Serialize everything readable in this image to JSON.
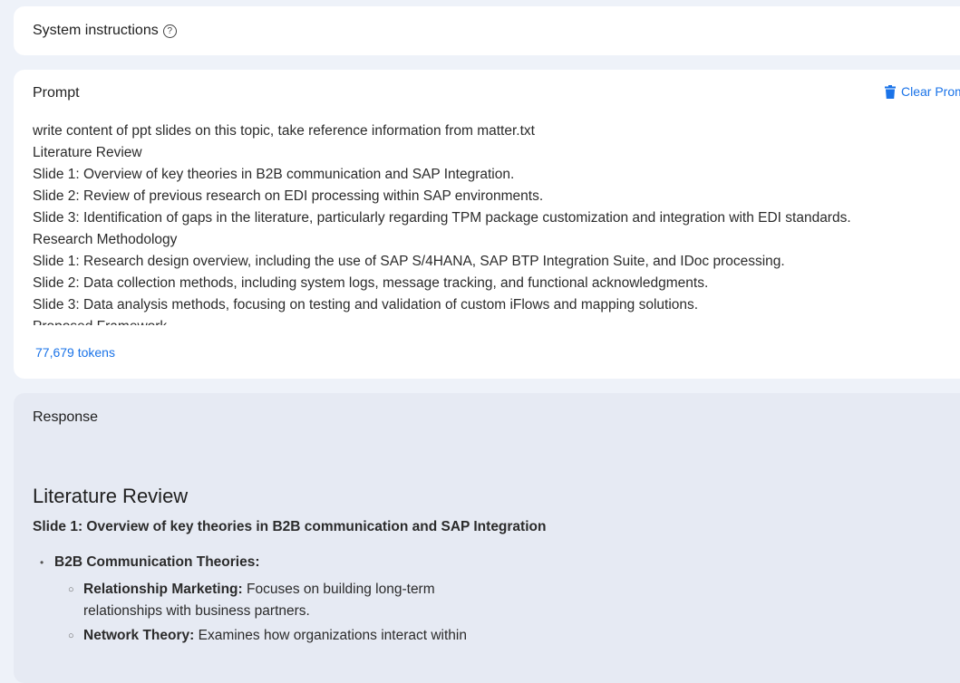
{
  "system": {
    "title": "System instructions",
    "help_glyph": "?"
  },
  "prompt": {
    "title": "Prompt",
    "clear_label": "Clear Prompt",
    "lines": [
      "write content of ppt slides on this topic, take reference information from matter.txt",
      "Literature Review",
      "Slide 1: Overview of key theories in B2B communication and SAP Integration.",
      "Slide 2: Review of previous research on EDI processing within SAP environments.",
      "Slide 3: Identification of gaps in the literature, particularly regarding TPM package customization and integration with EDI standards.",
      "Research Methodology",
      "Slide 1: Research design overview, including the use of SAP S/4HANA, SAP BTP Integration Suite, and IDoc processing.",
      "Slide 2: Data collection methods, including system logs, message tracking, and functional acknowledgments.",
      "Slide 3: Data analysis methods, focusing on testing and validation of custom iFlows and mapping solutions.",
      "Proposed Framework"
    ],
    "tokens": "77,679 tokens"
  },
  "response": {
    "title": "Response",
    "heading": "Literature Review",
    "slide_heading": "Slide 1: Overview of key theories in B2B communication and SAP Integration",
    "bullet": {
      "label": "B2B Communication Theories:",
      "items": [
        {
          "term": "Relationship Marketing:",
          "text": " Focuses on building long-term relationships with business partners."
        },
        {
          "term": "Network Theory:",
          "text": " Examines how organizations interact within"
        }
      ]
    }
  },
  "colors": {
    "accent": "#1a73e8",
    "page_bg": "#eef2f9",
    "response_bg": "#e6eaf3"
  }
}
